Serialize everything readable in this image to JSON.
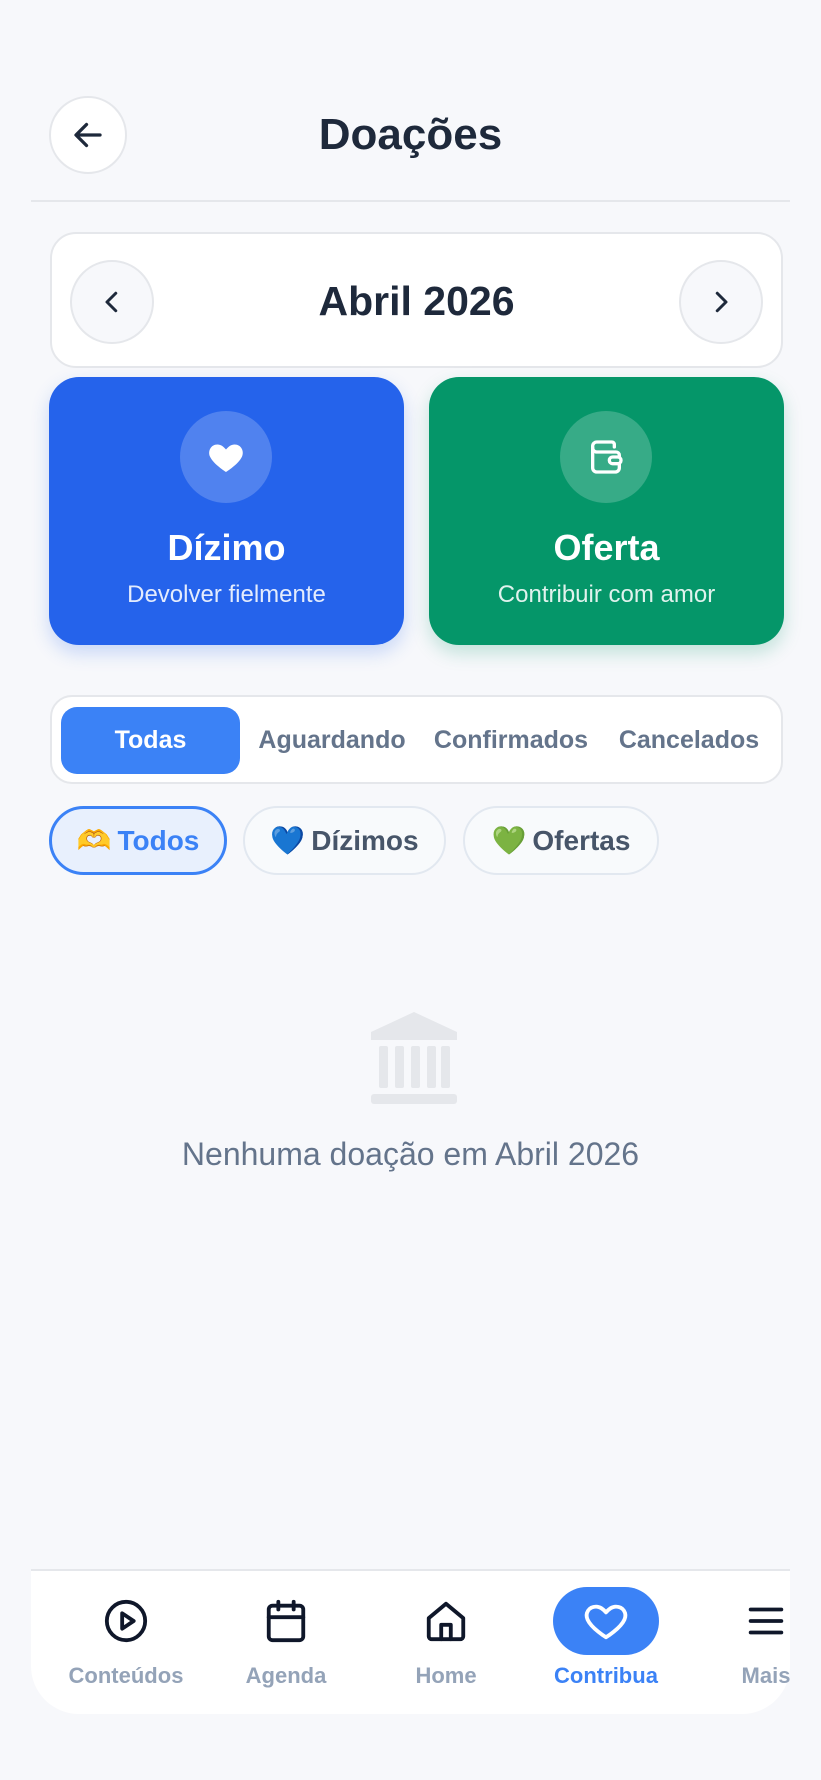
{
  "header": {
    "title": "Doações",
    "back_icon": "arrow-left-icon"
  },
  "month": {
    "label": "Abril 2026",
    "prev_icon": "chevron-left-icon",
    "next_icon": "chevron-right-icon"
  },
  "actions": [
    {
      "title": "Dízimo",
      "subtitle": "Devolver fielmente",
      "icon": "heart-icon",
      "color": "#2563eb"
    },
    {
      "title": "Oferta",
      "subtitle": "Contribuir com amor",
      "icon": "wallet-icon",
      "color": "#059669"
    }
  ],
  "status_tabs": {
    "items": [
      "Todas",
      "Aguardando",
      "Confirmados",
      "Cancelados"
    ],
    "active": "Todas"
  },
  "type_filters": {
    "items": [
      {
        "emoji": "🫶",
        "label": "Todos"
      },
      {
        "emoji": "💙",
        "label": "Dízimos"
      },
      {
        "emoji": "💚",
        "label": "Ofertas"
      }
    ],
    "active": "Todos"
  },
  "empty_state": {
    "icon": "bank-icon",
    "message": "Nenhuma doação em Abril 2026"
  },
  "bottom_nav": {
    "items": [
      {
        "label": "Conteúdos",
        "icon": "play-circle-icon"
      },
      {
        "label": "Agenda",
        "icon": "calendar-icon"
      },
      {
        "label": "Home",
        "icon": "home-icon"
      },
      {
        "label": "Contribua",
        "icon": "heart-icon"
      },
      {
        "label": "Mais",
        "icon": "menu-icon"
      }
    ],
    "active": "Contribua"
  },
  "colors": {
    "accent": "#3b82f6",
    "tithe": "#2563eb",
    "offer": "#059669",
    "background": "#f7f8fb"
  }
}
